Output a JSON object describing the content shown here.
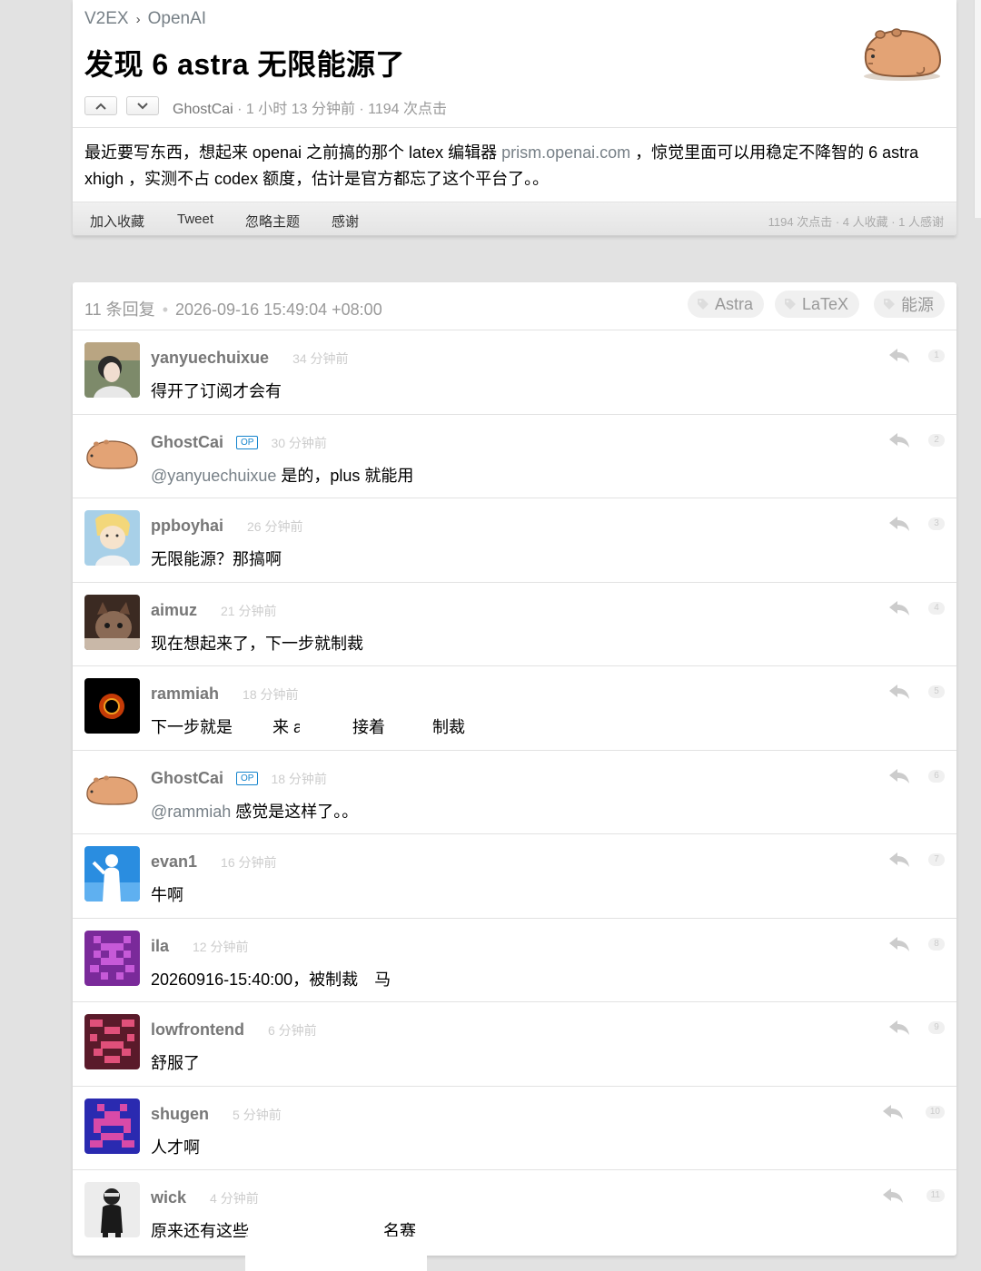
{
  "breadcrumb": {
    "site": "V2EX",
    "separator": "›",
    "node": "OpenAI"
  },
  "topic": {
    "title": "发现 6 astra 无限能源了",
    "author": "GhostCai",
    "meta_rest": " · 1 小时 13 分钟前 · 1194 次点击",
    "content_before": "最近要写东西，想起来 openai 之前搞的那个 latex 编辑器 ",
    "content_link": "prism.openai.com",
    "content_after": " ，惊觉里面可以用稳定不降智的 6 astra xhigh ，实测不占 codex 额度，估计是官方都忘了这个平台了。。",
    "icons": {
      "vote_up": "chevron-up-icon",
      "vote_down": "chevron-down-icon"
    }
  },
  "footer": {
    "links": [
      "加入收藏",
      "Tweet",
      "忽略主题",
      "感谢"
    ],
    "stats": "1194 次点击  ·  4 人收藏  ·  1 人感谢"
  },
  "replies_header": {
    "count": "11 条回复",
    "dot": "•",
    "date": "2026-09-16 15:49:04 +08:00",
    "tags": [
      "Astra",
      "LaTeX",
      "能源"
    ]
  },
  "replies": [
    {
      "user": "yanyuechuixue",
      "ago": "34 分钟前",
      "text": "得开了订阅才会有",
      "floor": "1"
    },
    {
      "user": "GhostCai",
      "op": "OP",
      "ago": "30 分钟前",
      "at": "@yanyuechuixue",
      "text": " 是的，plus 就能用",
      "floor": "2"
    },
    {
      "user": "ppboyhai",
      "ago": "26 分钟前",
      "text": "无限能源？那搞啊",
      "floor": "3"
    },
    {
      "user": "aimuz",
      "ago": "21 分钟前",
      "text": "现在想起来了，下一步就制裁",
      "floor": "4"
    },
    {
      "user": "rammiah",
      "ago": "18 分钟前",
      "text_a": "下一步就是",
      "text_b": "来 api 了，接着",
      "text_c": "制裁",
      "floor": "5"
    },
    {
      "user": "GhostCai",
      "op": "OP",
      "ago": "18 分钟前",
      "at": "@rammiah",
      "text": " 感觉是这样了。。",
      "floor": "6"
    },
    {
      "user": "evan1",
      "ago": "16 分钟前",
      "text": "牛啊",
      "floor": "7"
    },
    {
      "user": "ila",
      "ago": "12 分钟前",
      "text_a": "20260916-15:40:00，被制裁",
      "text_b": "马",
      "floor": "8"
    },
    {
      "user": "lowfrontend",
      "ago": "6 分钟前",
      "text": "舒服了",
      "floor": "9"
    },
    {
      "user": "shugen",
      "ago": "5 分钟前",
      "text": "人才啊",
      "floor": "10"
    },
    {
      "user": "wick",
      "ago": "4 分钟前",
      "text_a": "原来还有这些",
      "text_b": "名赛",
      "floor": "11"
    }
  ],
  "colors": {
    "link": "#778087",
    "op_badge": "#1484cd",
    "background": "#e2e2e2"
  }
}
